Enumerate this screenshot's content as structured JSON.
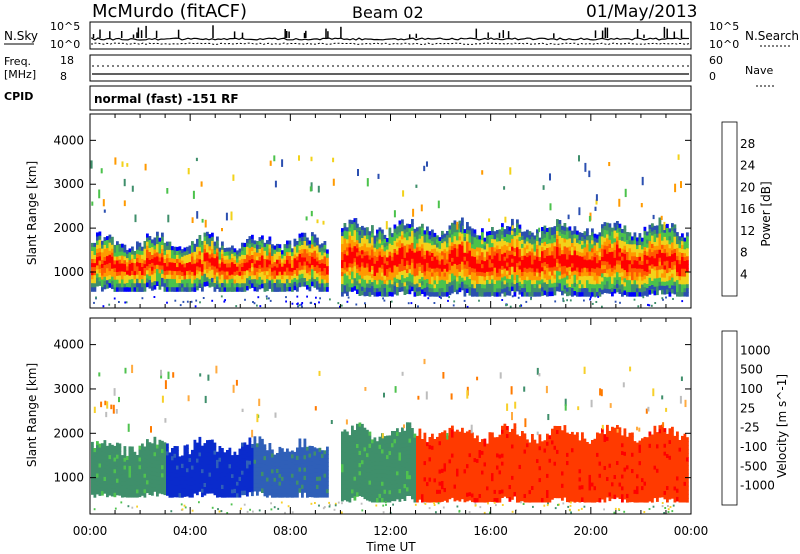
{
  "header": {
    "station": "McMurdo (fitACF)",
    "beam": "Beam 02",
    "date": "01/May/2013"
  },
  "noise_panel": {
    "left_label": "N.Sky",
    "left_ticks": [
      "10^5",
      "10^0"
    ],
    "right_label": "N.Search",
    "right_ticks": [
      "10^5",
      "10^0"
    ]
  },
  "freq_panel": {
    "left_label_1": "Freq.",
    "left_label_2": "[MHz]",
    "left_ticks": [
      "18",
      "8"
    ],
    "right_label": "Nave",
    "right_ticks": [
      "60",
      "0"
    ],
    "cpid_label": "CPID"
  },
  "mode_text": "normal (fast) -151 RF",
  "colors": {
    "power_scale": [
      "#0000ff",
      "#2b4fb0",
      "#3f8f6b",
      "#4bc24b",
      "#f2d21a",
      "#ff9a00",
      "#ff5a00",
      "#ff0000"
    ],
    "velocity_scale": [
      "#0a2bcc",
      "#2f5fb8",
      "#3f8f6b",
      "#4fc24f",
      "#bdbdbd",
      "#f7d02a",
      "#ffab40",
      "#ff7a00",
      "#ff3a00",
      "#ff0000"
    ]
  },
  "chart_data": [
    {
      "type": "heatmap",
      "title": "",
      "xlabel": "Time UT",
      "ylabel": "Slant Range [km]",
      "x_ticks": [
        "00:00",
        "04:00",
        "08:00",
        "12:00",
        "16:00",
        "20:00",
        "00:00"
      ],
      "xlim_hours": [
        0,
        24
      ],
      "ylim": [
        180,
        4600
      ],
      "y_ticks": [
        1000,
        2000,
        3000,
        4000
      ],
      "colorbar": {
        "label": "Power [dB]",
        "ticks": [
          4,
          8,
          12,
          16,
          20,
          24,
          28
        ]
      },
      "echo_regions": [
        {
          "t_start": 0.0,
          "t_end": 9.5,
          "range_low": 560,
          "range_high": 1700
        },
        {
          "t_start": 10.0,
          "t_end": 23.9,
          "range_low": 450,
          "range_high": 2000
        }
      ]
    },
    {
      "type": "heatmap",
      "title": "",
      "xlabel": "Time UT",
      "ylabel": "Slant Range [km]",
      "x_ticks": [
        "00:00",
        "04:00",
        "08:00",
        "12:00",
        "16:00",
        "20:00",
        "00:00"
      ],
      "xlim_hours": [
        0,
        24
      ],
      "ylim": [
        180,
        4600
      ],
      "y_ticks": [
        1000,
        2000,
        3000,
        4000
      ],
      "colorbar": {
        "label": "Velocity [m s^-1]",
        "ticks": [
          1000,
          500,
          100,
          25,
          -25,
          -100,
          -500,
          -1000
        ]
      },
      "velocity_bands": [
        {
          "t_start": 0.0,
          "t_end": 3.0,
          "velocity": 100
        },
        {
          "t_start": 3.0,
          "t_end": 6.5,
          "velocity": 700
        },
        {
          "t_start": 6.5,
          "t_end": 9.5,
          "velocity": 300
        },
        {
          "t_start": 10.0,
          "t_end": 13.0,
          "velocity": 100
        },
        {
          "t_start": 13.0,
          "t_end": 23.9,
          "velocity": -200
        }
      ]
    }
  ]
}
